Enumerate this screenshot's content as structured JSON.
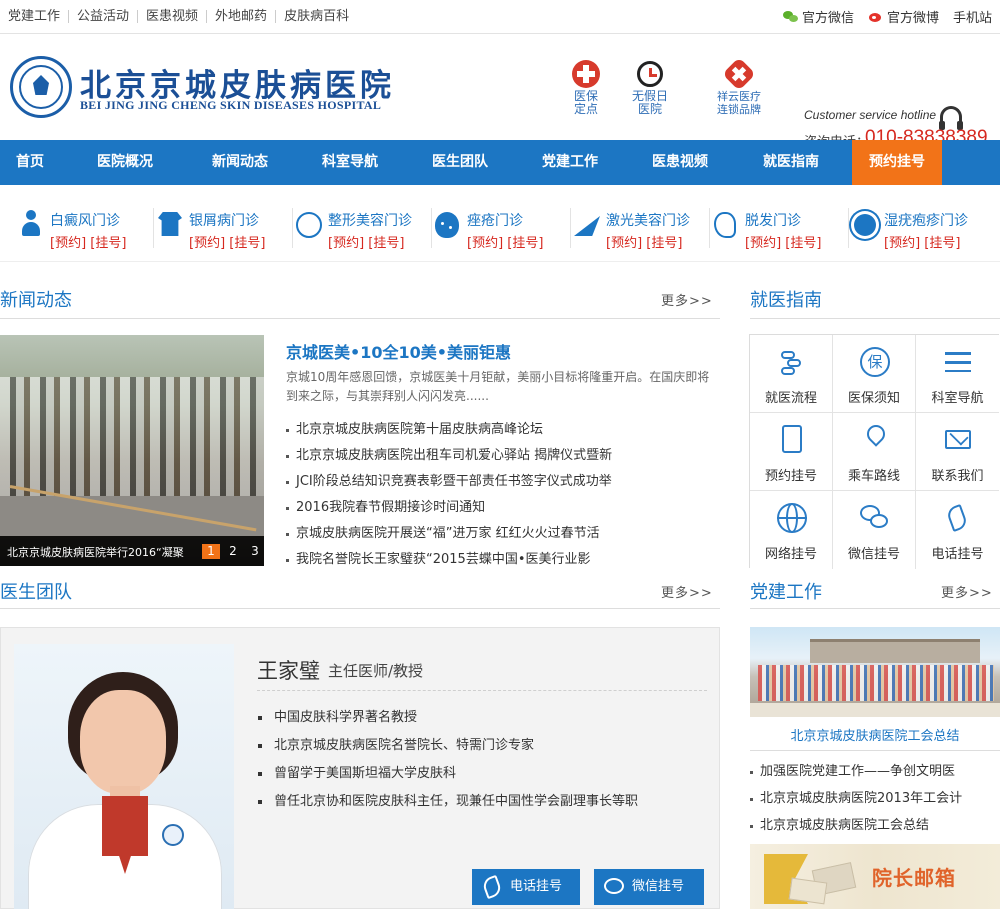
{
  "topbar": {
    "links": [
      "党建工作",
      "公益活动",
      "医患视频",
      "外地邮药",
      "皮肤病百科"
    ],
    "right": {
      "wechat": "官方微信",
      "weibo": "官方微博",
      "mobile": "手机站"
    }
  },
  "header": {
    "logo_cn": "北京京城皮肤病医院",
    "logo_en": "BEI JING JING CHENG SKIN DISEASES HOSPITAL",
    "features": [
      {
        "label": "医保\n定点",
        "icon": "medical-cross-icon"
      },
      {
        "label": "无假日\n医院",
        "icon": "clock-icon"
      },
      {
        "label": "祥云医疗\n连锁品牌",
        "icon": "cloud-cross-icon"
      }
    ],
    "hotline_label": "Customer service hotline",
    "phone_label": "咨询电话：",
    "phone_number": "010-83838389"
  },
  "nav": {
    "items": [
      "首页",
      "医院概况",
      "新闻动态",
      "科室导航",
      "医生团队",
      "党建工作",
      "医患视频",
      "就医指南",
      "预约挂号"
    ],
    "active_index": 8
  },
  "departments": [
    {
      "name": "白癜风门诊",
      "icon": "person-icon"
    },
    {
      "name": "银屑病门诊",
      "icon": "shirt-icon"
    },
    {
      "name": "整形美容门诊",
      "icon": "face-icon"
    },
    {
      "name": "痤疮门诊",
      "icon": "acne-face-icon"
    },
    {
      "name": "激光美容门诊",
      "icon": "laser-icon"
    },
    {
      "name": "脱发门诊",
      "icon": "hair-head-icon"
    },
    {
      "name": "湿疣疱疹门诊",
      "icon": "virus-icon"
    }
  ],
  "dept_links": {
    "book": "[预约]",
    "register": "[挂号]"
  },
  "news": {
    "title": "新闻动态",
    "more": "更多>>",
    "image_caption": "北京京城皮肤病医院举行2016“凝聚",
    "pager": [
      "1",
      "2",
      "3"
    ],
    "featured_title": "京城医美•10全10美•美丽钜惠",
    "featured_desc": "京城10周年感恩回馈，京城医美十月钜献，美丽小目标将隆重开启。在国庆即将到来之际，与其崇拜别人闪闪发亮......",
    "items": [
      "北京京城皮肤病医院第十届皮肤病高峰论坛",
      "北京京城皮肤病医院出租车司机爱心驿站 揭牌仪式暨新",
      "JCI阶段总结知识竞赛表彰暨干部责任书签字仪式成功举",
      "2016我院春节假期接诊时间通知",
      "京城皮肤病医院开展送“福”进万家  红红火火过春节活",
      "我院名誉院长王家璧获“2015芸蝶中国•医美行业影"
    ]
  },
  "doctors": {
    "title": "医生团队",
    "more": "更多>>",
    "name": "王家璧",
    "position": "主任医师/教授",
    "bio": [
      "中国皮肤科学界著名教授",
      "北京京城皮肤病医院名誉院长、特需门诊专家",
      "曾留学于美国斯坦福大学皮肤科",
      "曾任北京协和医院皮肤科主任，现兼任中国性学会副理事长等职"
    ],
    "phone_btn": "电话挂号",
    "wechat_btn": "微信挂号"
  },
  "guide": {
    "title": "就医指南",
    "items": [
      {
        "label": "就医流程",
        "icon": "flow-icon"
      },
      {
        "label": "医保须知",
        "icon": "insurance-icon"
      },
      {
        "label": "科室导航",
        "icon": "list-icon"
      },
      {
        "label": "预约挂号",
        "icon": "clipboard-icon"
      },
      {
        "label": "乘车路线",
        "icon": "location-pin-icon"
      },
      {
        "label": "联系我们",
        "icon": "mail-icon"
      },
      {
        "label": "网络挂号",
        "icon": "globe-icon"
      },
      {
        "label": "微信挂号",
        "icon": "wechat-icon"
      },
      {
        "label": "电话挂号",
        "icon": "phone-icon"
      }
    ],
    "insurance_glyph": "保"
  },
  "party": {
    "title": "党建工作",
    "more": "更多>>",
    "image_caption": "北京京城皮肤病医院工会总结",
    "items": [
      "加强医院党建工作——争创文明医",
      "北京京城皮肤病医院2013年工会计",
      "北京京城皮肤病医院工会总结"
    ],
    "mailbox": "院长邮箱"
  },
  "colors": {
    "primary": "#1c76c3",
    "accent": "#f27318",
    "red": "#d6281f"
  }
}
